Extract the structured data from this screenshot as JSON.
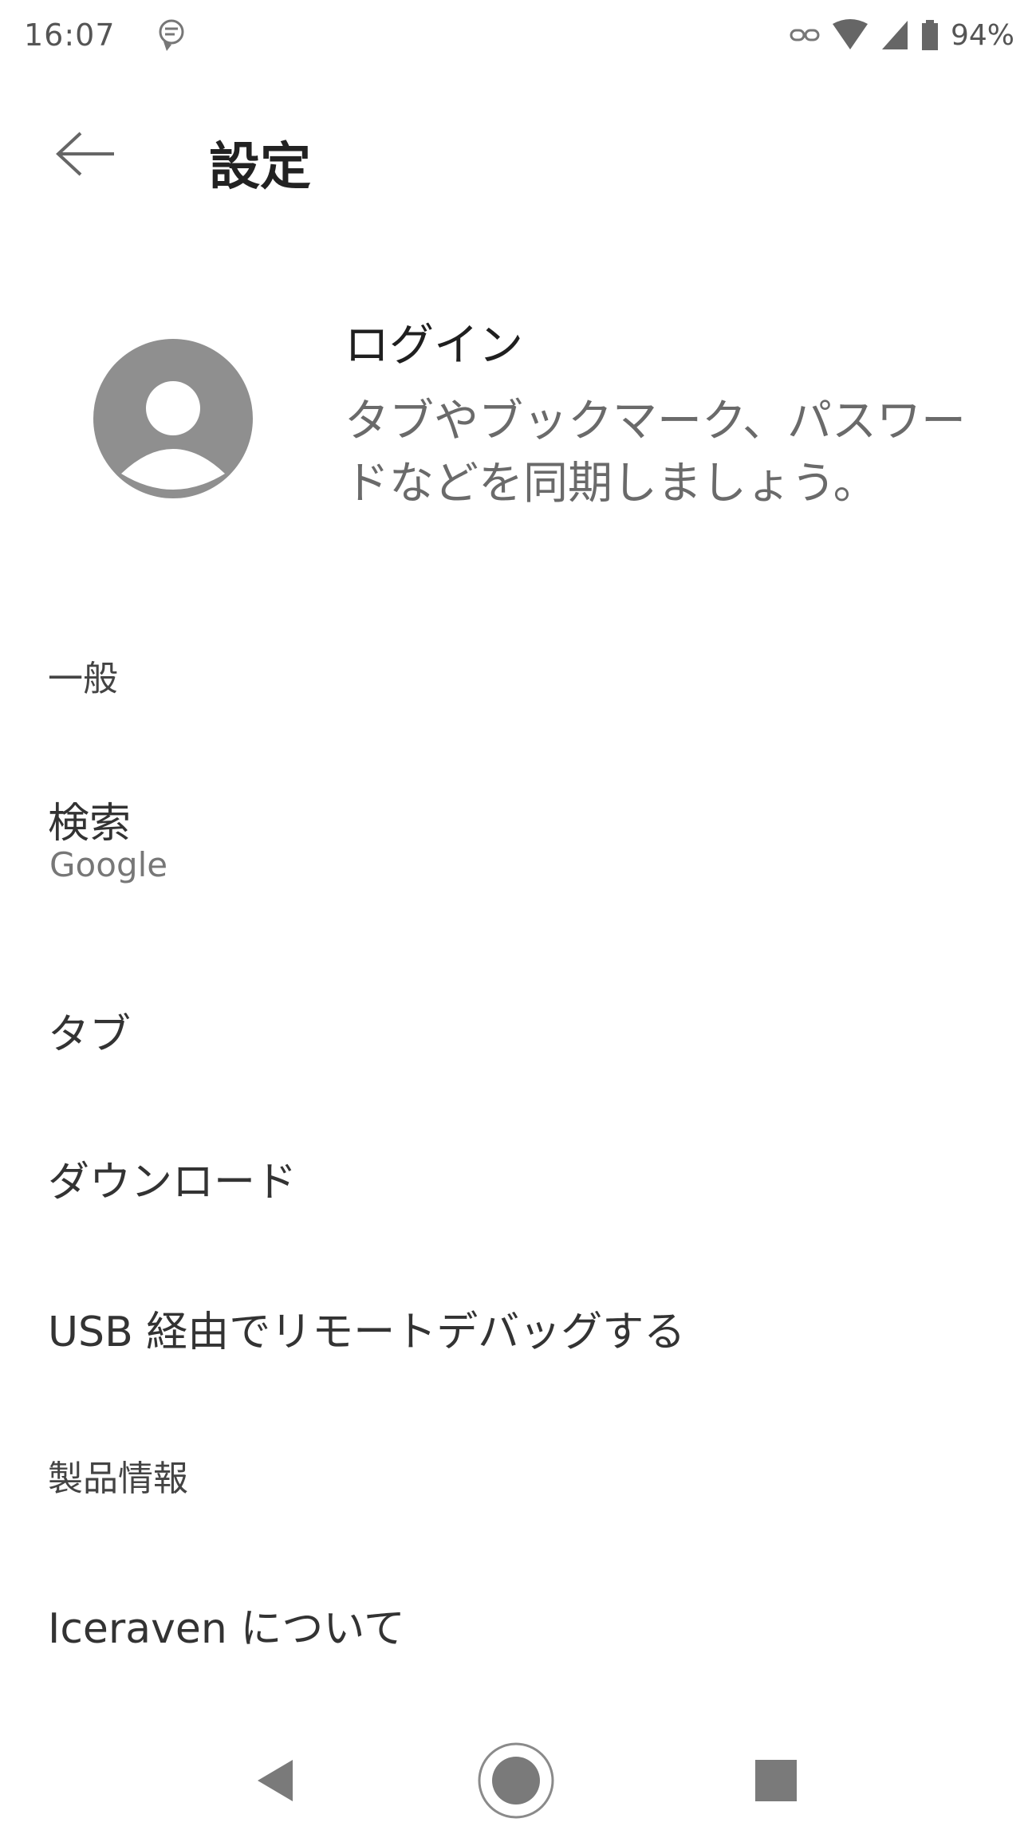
{
  "status_bar": {
    "time": "16:07",
    "battery": "94%"
  },
  "app_bar": {
    "title": "設定"
  },
  "account": {
    "title": "ログイン",
    "description": "タブやブックマーク、パスワードなどを同期しましょう。"
  },
  "sections": {
    "general": "一般",
    "product_info": "製品情報"
  },
  "items": {
    "search_title": "検索",
    "search_summary": "Google",
    "tabs_title": "タブ",
    "downloads_title": "ダウンロード",
    "remote_debug_title": "USB 経由でリモートデバッグする",
    "about_title": "Iceraven について"
  },
  "icons": {
    "back": "arrow-left-icon",
    "avatar": "account-circle-icon",
    "nav_back": "triangle-back-icon",
    "nav_home": "circle-home-icon",
    "nav_recents": "square-recents-icon"
  }
}
